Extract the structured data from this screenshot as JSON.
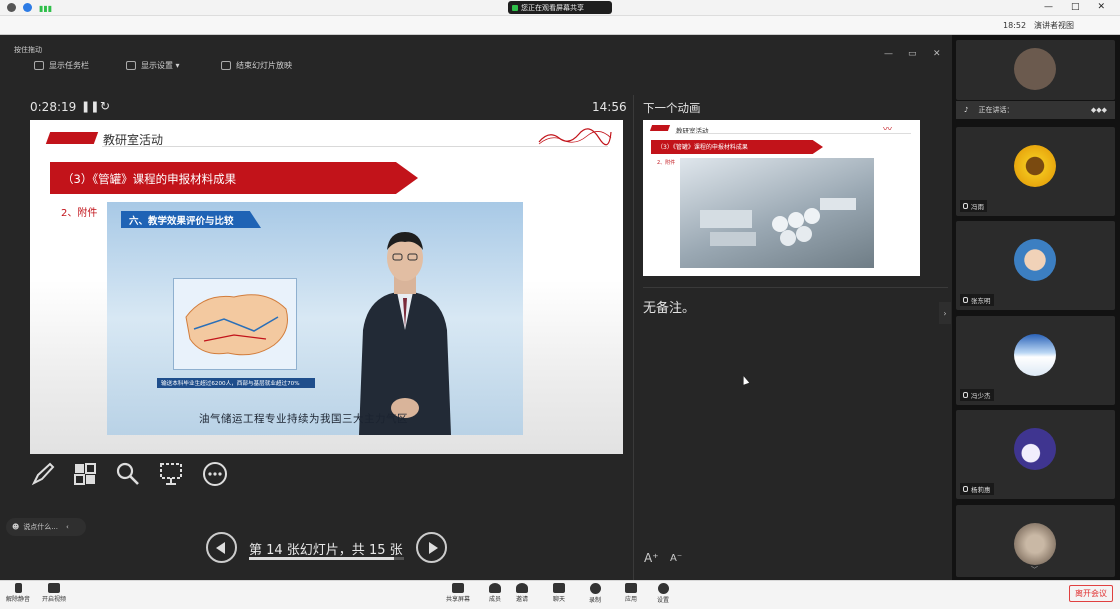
{
  "top_bar": {
    "share_status": "您正在观看屏幕共享",
    "clock": "18:52",
    "view_label": "演讲者视图",
    "window_controls": [
      "—",
      "□",
      "✕"
    ]
  },
  "presenter": {
    "window_title": "按住拖动",
    "toolbar": [
      "显示任务栏",
      "显示设置 ▾",
      "结束幻灯片放映"
    ],
    "window_controls": [
      "—",
      "▭",
      "✕"
    ],
    "elapsed": "0:28:19",
    "current_time": "14:56",
    "slide": {
      "section_title": "教研室活动",
      "banner": "（3）《管罐》课程的申报材料成果",
      "attach_label": "2、附件",
      "video_heading": "六、教学效果评价与比较",
      "video_strip": "输送本科毕业生超过6200人，西部与基层就业超过70%",
      "video_subtitle": "油气储运工程专业持续为我国三大主力气区"
    },
    "tools": [
      "pen-icon",
      "switch-slides-icon",
      "zoom-icon",
      "screen-icon",
      "more-icon"
    ],
    "nav": {
      "label": "第 14 张幻灯片，共 15 张",
      "current": 14,
      "total": 15
    },
    "chat_hint": "说点什么..."
  },
  "next": {
    "heading": "下一个动画",
    "thumb_title": "教研室活动",
    "thumb_banner": "（3）《管罐》课程的申报材料成果",
    "thumb_attach": "2、附件"
  },
  "notes": {
    "text": "无备注。",
    "font_bigger": "A⁺",
    "font_smaller": "A⁻"
  },
  "sidebar": {
    "speaking_label": "正在讲话：",
    "participants": [
      {
        "name": "",
        "avatar_color": "#6b5a4e"
      },
      {
        "name": "冯雨",
        "avatar_color": "#f2c21b"
      },
      {
        "name": "张东明",
        "avatar_color": "#3c7fc2"
      },
      {
        "name": "冯少杰",
        "avatar_color": "#7fb2e8"
      },
      {
        "name": "杨莉惠",
        "avatar_color": "#3f3590"
      },
      {
        "name": "",
        "avatar_color": "#9c8b7a"
      }
    ]
  },
  "bottom_bar": {
    "items": [
      "解除静音",
      "开启视频",
      "共享屏幕",
      "成员",
      "邀请",
      "聊天",
      "录制",
      "应用",
      "设置"
    ],
    "leave": "离开会议"
  },
  "colors": {
    "accent_red": "#c2131a",
    "video_blue": "#1f63b5"
  }
}
